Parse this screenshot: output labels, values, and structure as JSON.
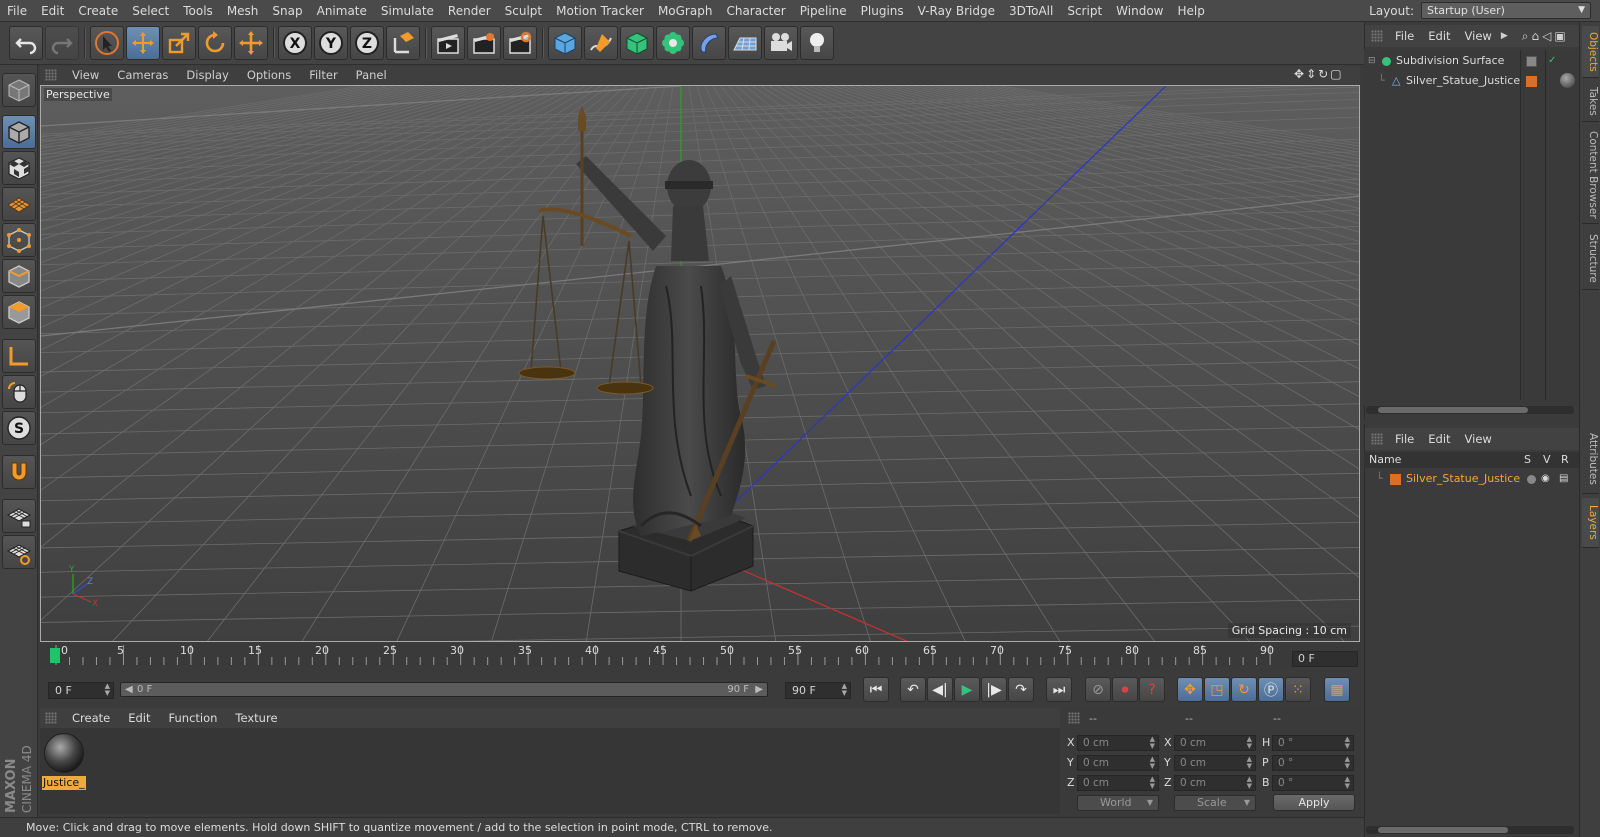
{
  "menu": [
    "File",
    "Edit",
    "Create",
    "Select",
    "Tools",
    "Mesh",
    "Snap",
    "Animate",
    "Simulate",
    "Render",
    "Sculpt",
    "Motion Tracker",
    "MoGraph",
    "Character",
    "Pipeline",
    "Plugins",
    "V-Ray Bridge",
    "3DToAll",
    "Script",
    "Window",
    "Help"
  ],
  "layout": {
    "label": "Layout:",
    "value": "Startup (User)"
  },
  "viewport": {
    "menu": [
      "View",
      "Cameras",
      "Display",
      "Options",
      "Filter",
      "Panel"
    ],
    "label": "Perspective",
    "grid_spacing": "Grid Spacing : 10 cm"
  },
  "timeline": {
    "ticks": [
      "0",
      "5",
      "10",
      "15",
      "20",
      "25",
      "30",
      "35",
      "40",
      "45",
      "50",
      "55",
      "60",
      "65",
      "70",
      "75",
      "80",
      "85",
      "90"
    ],
    "current_frame": "0 F",
    "start_field": "0 F",
    "range_start": "0 F",
    "range_end": "90 F",
    "end_field": "90 F"
  },
  "material_manager": {
    "menu": [
      "Create",
      "Edit",
      "Function",
      "Texture"
    ],
    "material_name": "Justice_"
  },
  "coordinates": {
    "headers": [
      "--",
      "--",
      "--"
    ],
    "rows": [
      {
        "a": "X",
        "av": "0 cm",
        "b": "X",
        "bv": "0 cm",
        "c": "H",
        "cv": "0 °"
      },
      {
        "a": "Y",
        "av": "0 cm",
        "b": "Y",
        "bv": "0 cm",
        "c": "P",
        "cv": "0 °"
      },
      {
        "a": "Z",
        "av": "0 cm",
        "b": "Z",
        "bv": "0 cm",
        "c": "B",
        "cv": "0 °"
      }
    ],
    "mode": "World",
    "scale_mode": "Scale",
    "apply": "Apply"
  },
  "status": "Move: Click and drag to move elements. Hold down SHIFT to quantize movement / add to the selection in point mode, CTRL to remove.",
  "object_manager": {
    "menu": [
      "File",
      "Edit",
      "View"
    ],
    "objects": [
      {
        "name": "Subdivision Surface"
      },
      {
        "name": "Silver_Statue_Justice"
      }
    ]
  },
  "layer_manager": {
    "menu": [
      "File",
      "Edit",
      "View"
    ],
    "columns": {
      "name": "Name",
      "s": "S",
      "v": "V",
      "r": "R"
    },
    "layers": [
      {
        "name": "Silver_Statue_Justice",
        "color": "#d8702a"
      }
    ]
  },
  "right_tabs": [
    "Objects",
    "Takes",
    "Content Browser",
    "Structure",
    "Attributes",
    "Layers"
  ],
  "brand": {
    "maxon": "MAXON",
    "product": "CINEMA 4D"
  },
  "colors": {
    "accent_blue": "#5b7fad",
    "highlight_orange": "#f2a93b",
    "playhead_green": "#1fc46a"
  }
}
